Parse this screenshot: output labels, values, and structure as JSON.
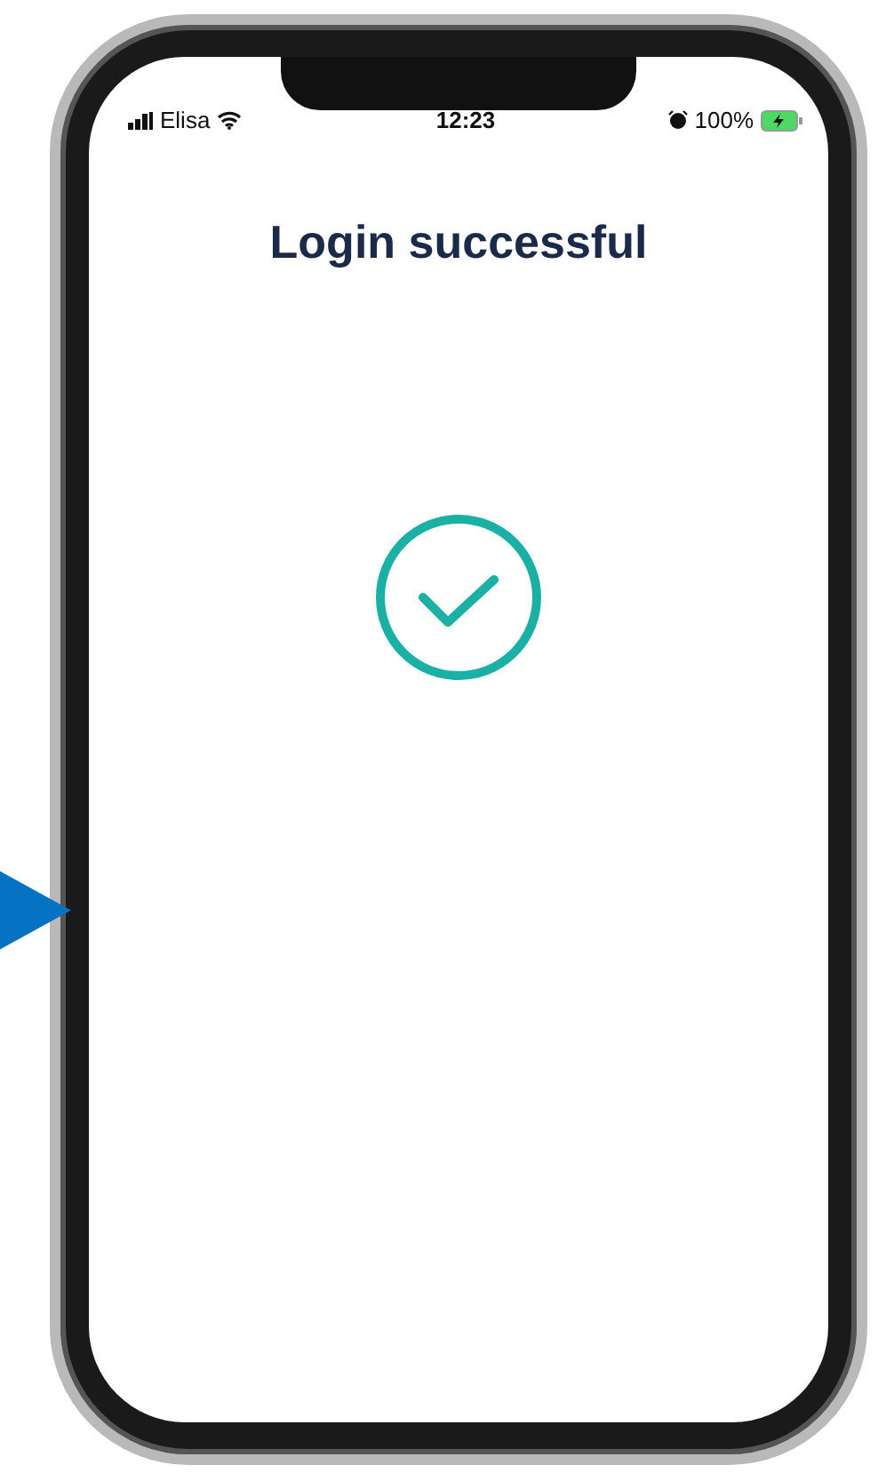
{
  "status_bar": {
    "carrier": "Elisa",
    "time": "12:23",
    "battery": "100%"
  },
  "title": "Login successful"
}
